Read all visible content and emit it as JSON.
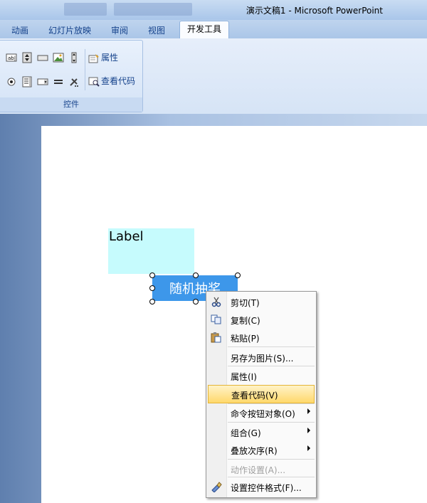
{
  "window": {
    "title": "演示文稿1 - Microsoft PowerPoint"
  },
  "tabs": [
    {
      "label": "动画"
    },
    {
      "label": "幻灯片放映"
    },
    {
      "label": "审阅"
    },
    {
      "label": "视图"
    },
    {
      "label": "开发工具",
      "active": true
    }
  ],
  "ribbon": {
    "group_label": "控件",
    "properties_label": "属性",
    "view_code_label": "查看代码"
  },
  "slide": {
    "label_text": "Label",
    "button_text": "随机抽奖"
  },
  "context_menu": {
    "items": [
      {
        "label": "剪切(T)",
        "icon": "scissors-icon"
      },
      {
        "label": "复制(C)",
        "icon": "copy-icon"
      },
      {
        "label": "粘贴(P)",
        "icon": "paste-icon"
      },
      {
        "label": "另存为图片(S)..."
      },
      {
        "label": "属性(I)"
      },
      {
        "label": "查看代码(V)",
        "highlighted": true
      },
      {
        "label": "命令按钮对象(O)",
        "submenu": true
      },
      {
        "label": "组合(G)",
        "submenu": true
      },
      {
        "label": "叠放次序(R)",
        "submenu": true
      },
      {
        "label": "动作设置(A)...",
        "disabled": true
      },
      {
        "label": "设置控件格式(F)...",
        "icon": "format-control-icon"
      }
    ]
  },
  "colors": {
    "label_bg": "#c6fbfd",
    "button_bg": "#3d97ea",
    "menu_highlight": "#ffd86b"
  }
}
